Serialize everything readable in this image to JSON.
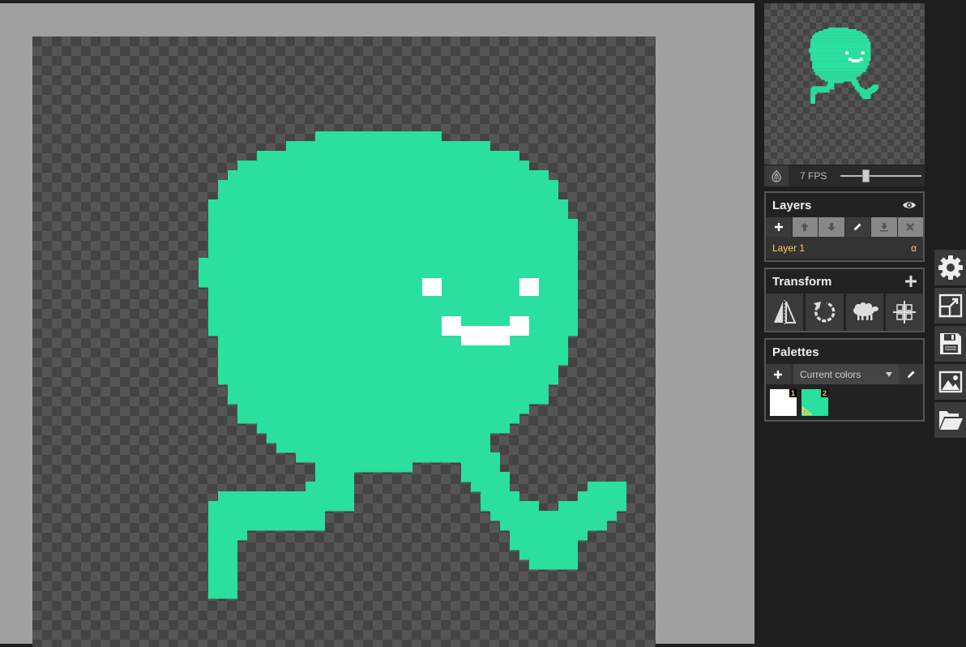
{
  "colors": {
    "sprite": "#2bdf9e",
    "face": "#ffffff",
    "accent_yellow": "#ffd24a"
  },
  "preview": {
    "fps_label": "7 FPS",
    "fps_value": 7,
    "onion_icon": "onion-skin-icon"
  },
  "layers": {
    "title": "Layers",
    "tools": [
      "add-layer-icon",
      "move-up-icon",
      "move-down-icon",
      "edit-layer-icon",
      "merge-down-icon",
      "delete-layer-icon"
    ],
    "items": [
      {
        "name": "Layer 1",
        "alpha": "α"
      }
    ]
  },
  "transform": {
    "title": "Transform",
    "tools": [
      "flip-icon",
      "rotate-icon",
      "clone-sheep-icon",
      "center-align-icon"
    ]
  },
  "palettes": {
    "title": "Palettes",
    "selected": "Current colors",
    "swatches": [
      {
        "number": "1",
        "color": "#ffffff"
      },
      {
        "number": "2",
        "color": "#2bdf9e"
      }
    ]
  },
  "side_tools": [
    "settings-icon",
    "resize-icon",
    "save-icon",
    "import-image-icon",
    "open-folder-icon"
  ]
}
